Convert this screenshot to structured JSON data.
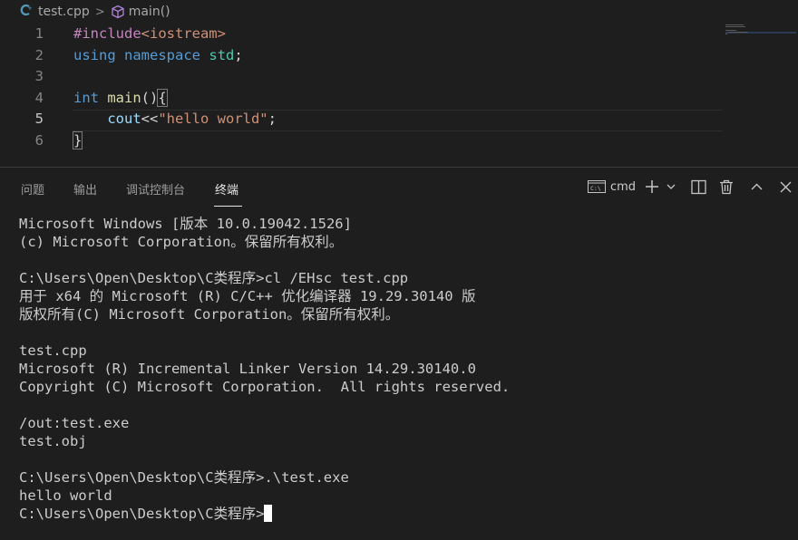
{
  "breadcrumb": {
    "file_icon": "cpp-file-icon",
    "file": "test.cpp",
    "separator": ">",
    "symbol_icon": "cube-method-icon",
    "symbol": "main()"
  },
  "editor": {
    "line_numbers": [
      "1",
      "2",
      "3",
      "4",
      "5",
      "6"
    ],
    "active_line": "5",
    "lines": [
      [
        {
          "t": "#include",
          "c": "kw-pp"
        },
        {
          "t": "<iostream>",
          "c": "inc"
        }
      ],
      [
        {
          "t": "using",
          "c": "kw"
        },
        {
          "t": " ",
          "c": "punc"
        },
        {
          "t": "namespace",
          "c": "kw"
        },
        {
          "t": " ",
          "c": "punc"
        },
        {
          "t": "std",
          "c": "ns"
        },
        {
          "t": ";",
          "c": "punc"
        }
      ],
      [],
      [
        {
          "t": "int",
          "c": "kw"
        },
        {
          "t": " ",
          "c": "punc"
        },
        {
          "t": "main",
          "c": "fn"
        },
        {
          "t": "()",
          "c": "punc"
        },
        {
          "t": "{",
          "c": "brace"
        }
      ],
      [
        {
          "t": "    ",
          "c": "punc"
        },
        {
          "t": "cout",
          "c": "var"
        },
        {
          "t": "<<",
          "c": "punc"
        },
        {
          "t": "\"hello world\"",
          "c": "str"
        },
        {
          "t": ";",
          "c": "punc"
        }
      ],
      [
        {
          "t": "}",
          "c": "brace"
        }
      ]
    ]
  },
  "panel": {
    "tabs": [
      {
        "label": "问题",
        "active": false
      },
      {
        "label": "输出",
        "active": false
      },
      {
        "label": "调试控制台",
        "active": false
      },
      {
        "label": "终端",
        "active": true
      }
    ],
    "terminal_type": "cmd",
    "actions": [
      "terminal-icon",
      "plus-icon",
      "chevron-down-icon",
      "split-icon",
      "trash-icon",
      "chevron-up-icon",
      "close-icon"
    ]
  },
  "terminal": {
    "lines": [
      "Microsoft Windows [版本 10.0.19042.1526]",
      "(c) Microsoft Corporation。保留所有权利。",
      "",
      "C:\\Users\\Open\\Desktop\\C类程序>cl /EHsc test.cpp",
      "用于 x64 的 Microsoft (R) C/C++ 优化编译器 19.29.30140 版",
      "版权所有(C) Microsoft Corporation。保留所有权利。",
      "",
      "test.cpp",
      "Microsoft (R) Incremental Linker Version 14.29.30140.0",
      "Copyright (C) Microsoft Corporation.  All rights reserved.",
      "",
      "/out:test.exe",
      "test.obj",
      "",
      "C:\\Users\\Open\\Desktop\\C类程序>.\\test.exe",
      "hello world",
      "C:\\Users\\Open\\Desktop\\C类程序>"
    ]
  },
  "colors": {
    "background": "#1e1e1e",
    "keyword": "#569cd6",
    "preprocessor": "#c586c0",
    "string": "#ce9178",
    "namespace": "#4ec9b0",
    "function": "#dcdcaa",
    "variable": "#9cdcfe"
  }
}
